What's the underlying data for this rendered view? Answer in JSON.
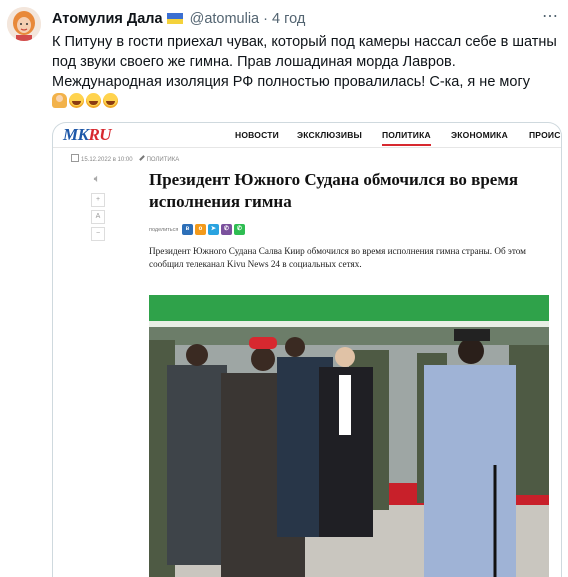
{
  "tweet": {
    "author_name": "Атомулия Дала",
    "author_flag": "ukraine-flag",
    "handle": "@atomulia",
    "separator": "·",
    "time": "4 год",
    "text": "К Питуну в гости приехал чувак, который под камеры нассал себе в шатны под звуки своего же гимна. Прав лошадиная морда Лавров. Международная изоляция РФ полностью провалилась! С-ка, я не могу",
    "emojis": [
      "woman-facepalming",
      "face-with-tears-of-joy",
      "face-with-tears-of-joy",
      "face-with-tears-of-joy"
    ],
    "more_icon": "more-horizontal-icon"
  },
  "article": {
    "logo_mk": "MK",
    "logo_ru": "RU",
    "nav": [
      "НОВОСТИ",
      "ЭКСКЛЮЗИВЫ",
      "ПОЛИТИКА",
      "ЭКОНОМИКА",
      "ПРОИС"
    ],
    "active_nav": "ПОЛИТИКА",
    "date": "15.12.2022 в 10:00",
    "rubric": "ПОЛИТИКА",
    "headline": "Президент Южного Судана обмочился во время исполнения гимна",
    "share_label": "поделиться",
    "share_buttons": [
      "ВК",
      "ОК",
      "TG",
      "VB",
      "WA"
    ],
    "tools": [
      "speaker-icon",
      "+",
      "A",
      "−"
    ],
    "lead": "Президент Южного Судана Салва Киир обмочился во время исполнения гимна страны. Об этом сообщил телеканал Kivu News 24 в социальных сетях."
  },
  "colors": {
    "mk_blue": "#1d57a8",
    "mk_red": "#d7282f",
    "tent_green": "#2fa24a",
    "carpet_red": "#c8202a"
  }
}
